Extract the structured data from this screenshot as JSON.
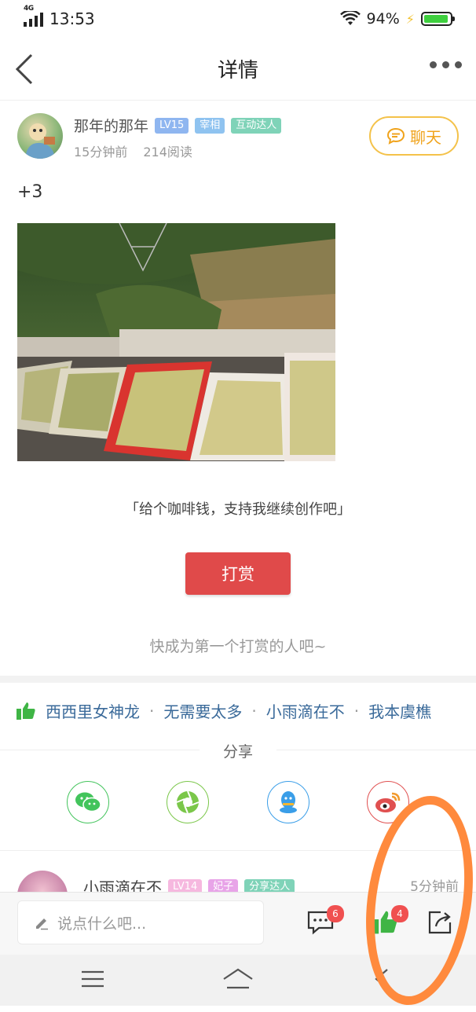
{
  "status_bar": {
    "network": "4G",
    "time": "13:53",
    "battery": "94%",
    "battery_level": 0.94
  },
  "navbar": {
    "title": "详情"
  },
  "author": {
    "name": "那年的那年",
    "badges": [
      "LV15",
      "宰相",
      "互动达人"
    ],
    "time_ago": "15分钟前",
    "reads": "214阅读",
    "chat_label": "聊天"
  },
  "post": {
    "text": "+3"
  },
  "reward": {
    "tip": "「给个咖啡钱，支持我继续创作吧」",
    "button": "打赏",
    "first_text": "快成为第一个打赏的人吧~"
  },
  "likes": {
    "users": [
      "西西里女神龙",
      "无需要太多",
      "小雨滴在不",
      "我本虞樵"
    ],
    "separator": "·"
  },
  "share": {
    "title": "分享",
    "targets": [
      "wechat-icon",
      "moments-icon",
      "qq-icon",
      "weibo-icon"
    ]
  },
  "comment": {
    "name": "小雨滴在不",
    "badges": [
      "LV14",
      "妃子",
      "分享达人"
    ],
    "time": "5分钟前"
  },
  "bottom_bar": {
    "placeholder": "说点什么吧...",
    "comment_count": "6",
    "like_count": "4"
  },
  "colors": {
    "accent_red": "#e04a4a",
    "chat_yellow": "#f4c24a",
    "link_blue": "#3a6a9a",
    "annotation_orange": "#ff8a3d"
  }
}
